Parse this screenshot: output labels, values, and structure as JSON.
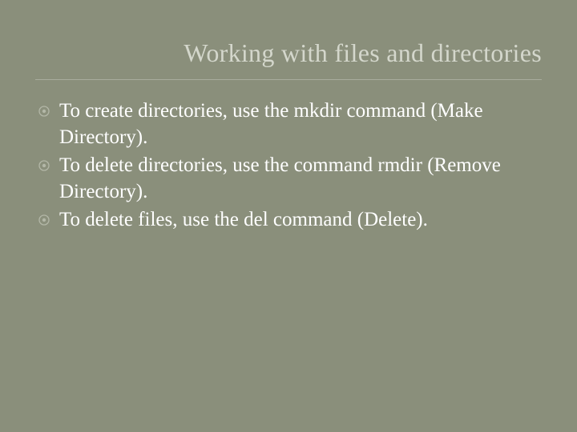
{
  "title": "Working with files and directories",
  "bullets": [
    {
      "text": "To create directories, use the mkdir command (Make Directory)."
    },
    {
      "text": "To delete directories, use the command rmdir (Remove Directory)."
    },
    {
      "text": "To delete files, use the del command (Delete)."
    }
  ]
}
